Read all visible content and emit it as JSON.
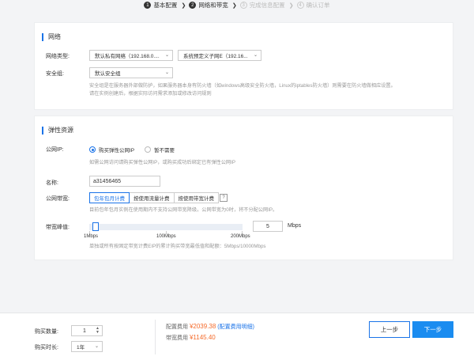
{
  "steps": [
    {
      "num": "1",
      "label": "基本配置",
      "state": "done"
    },
    {
      "num": "2",
      "label": "网络和带宽",
      "state": "active"
    },
    {
      "num": "3",
      "label": "完成信息配置",
      "state": "pending"
    },
    {
      "num": "4",
      "label": "确认订单",
      "state": "pending"
    }
  ],
  "network": {
    "title": "网络",
    "type_label": "网络类型:",
    "vpc_select": "默认私有网络（192.168.0....",
    "subnet_select": "系统预定义子网E（192.16...",
    "sg_label": "安全组:",
    "sg_select": "默认安全组",
    "hint_line1": "安全组是在服务器外部做防护，如果服务器本身有防火墙（如windows高级安全防火墙，Linux的iptables防火墙）则需要在防火墙做相应设置。",
    "hint_line2": "请在实例创建后，根据实际访问需求添加或修改访问规则"
  },
  "eip": {
    "title": "弹性资源",
    "public_ip_label": "公网IP:",
    "radio_buy": "购买弹性公网IP",
    "radio_none": "暂不需要",
    "public_ip_hint": "如需公网访问请购买弹性公网IP，或购买成功后绑定已有弹性公网IP",
    "name_label": "名称:",
    "name_value": "a31456465",
    "bandwidth_label": "公网带宽:",
    "bw_options": [
      "包年包月计费",
      "按使用流量计费",
      "按使用带宽计费"
    ],
    "bw_selected": "包年包月计费",
    "help": "?",
    "bw_hint": "目前包年包月实例在使用期内不支持公网带宽降级。公网带宽为0时，将不分配公网IP。",
    "peak_label": "带宽峰值:",
    "peak_value": "5",
    "peak_unit": "Mbps",
    "peak_fraction": 0.025,
    "ticks": [
      "1Mbps",
      "100Mbps",
      "200Mbps"
    ],
    "range_hint": "单独或所有按固定带宽计费EIP的累计购买带宽最低值和配额：5Mbps/10000Mbps"
  },
  "footer": {
    "qty_label": "购买数量:",
    "qty_value": "1",
    "dur_label": "购买时长:",
    "dur_value": "1年",
    "config_fee_label": "配置费用",
    "config_fee": "¥2039.38",
    "config_link": "(配置费用明细)",
    "bw_fee_label": "带宽费用",
    "bw_fee": "¥1145.40",
    "prev_label": "上一步",
    "next_label": "下一步"
  },
  "colors": {
    "accent": "#1a73e8",
    "price": "#f56c2c",
    "next_button": "#1a8cf0"
  }
}
